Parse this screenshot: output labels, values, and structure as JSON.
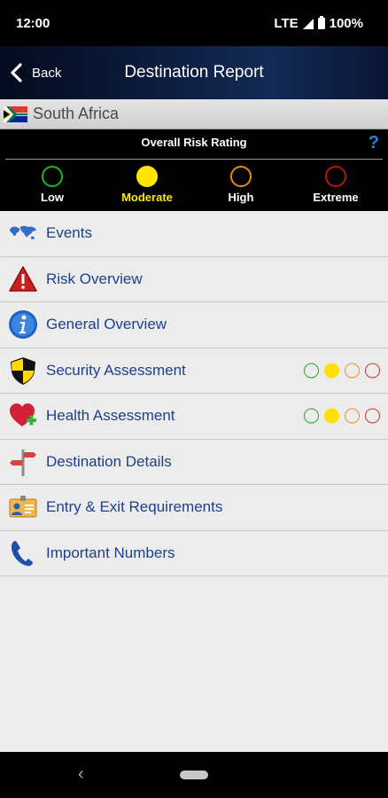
{
  "status_bar": {
    "time": "12:00",
    "network": "LTE",
    "battery": "100%"
  },
  "header": {
    "back_label": "Back",
    "title": "Destination Report"
  },
  "country": {
    "name": "South Africa",
    "flag_icon": "south-africa-flag-icon"
  },
  "risk_rating": {
    "title": "Overall Risk Rating",
    "help_label": "?",
    "levels": [
      {
        "label": "Low",
        "color": "#1fb51f",
        "selected": false
      },
      {
        "label": "Moderate",
        "color": "#ffe600",
        "selected": true
      },
      {
        "label": "High",
        "color": "#e88a12",
        "selected": false
      },
      {
        "label": "Extreme",
        "color": "#b81414",
        "selected": false
      }
    ]
  },
  "menu": {
    "items": [
      {
        "label": "Events",
        "icon": "world-map-icon"
      },
      {
        "label": "Risk Overview",
        "icon": "warning-triangle-icon"
      },
      {
        "label": "General Overview",
        "icon": "info-icon"
      },
      {
        "label": "Security Assessment",
        "icon": "shield-icon",
        "rating": "Moderate"
      },
      {
        "label": "Health Assessment",
        "icon": "heart-plus-icon",
        "rating": "Moderate"
      },
      {
        "label": "Destination Details",
        "icon": "signpost-icon"
      },
      {
        "label": "Entry & Exit Requirements",
        "icon": "id-card-icon"
      },
      {
        "label": "Important Numbers",
        "icon": "phone-icon"
      }
    ]
  }
}
